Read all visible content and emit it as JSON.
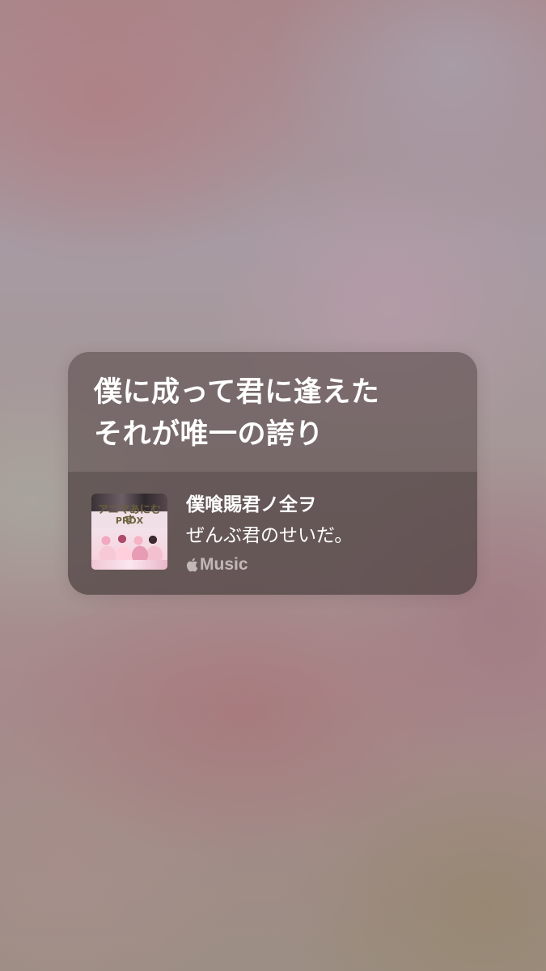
{
  "lyrics_card": {
    "lyric_lines": [
      "僕に成って君に逢えた",
      "それが唯一の誇り"
    ],
    "track": {
      "title": "僕喰賜君ノ全ヲ",
      "artist": "ぜんぶ君のせいだ。",
      "service": {
        "icon": "apple-logo-icon",
        "label": "Music"
      },
      "artwork": {
        "title_line_1": "アニマあにむす",
        "title_line_2": "PRDX"
      }
    }
  }
}
